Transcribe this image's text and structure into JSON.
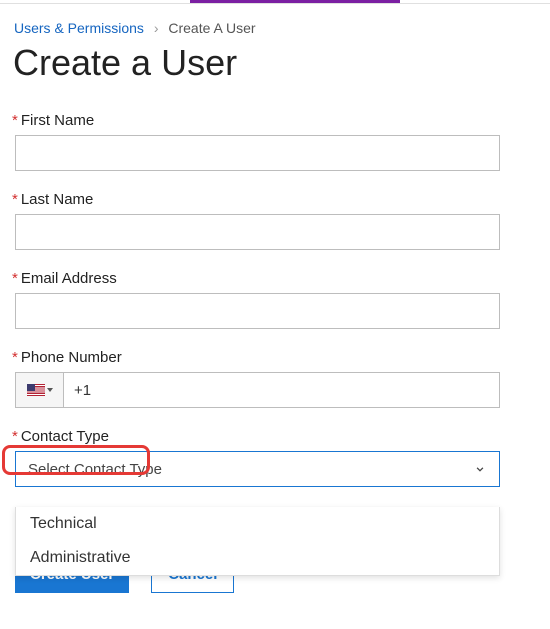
{
  "breadcrumb": {
    "root": "Users & Permissions",
    "current": "Create A User"
  },
  "title": "Create a User",
  "labels": {
    "first_name": "First Name",
    "last_name": "Last Name",
    "email": "Email Address",
    "phone": "Phone Number",
    "contact_type": "Contact Type"
  },
  "values": {
    "first_name": "",
    "last_name": "",
    "email": "",
    "phone": "+1",
    "contact_type_selected": "Select Contact Type"
  },
  "contact_type_options": [
    "Technical",
    "Administrative"
  ],
  "buttons": {
    "submit": "Create User",
    "cancel": "Cancel"
  },
  "required_marker": "*"
}
